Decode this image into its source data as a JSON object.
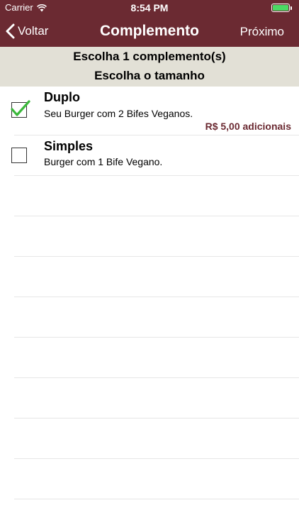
{
  "status_bar": {
    "carrier": "Carrier",
    "time": "8:54 PM",
    "battery_level": 1.0
  },
  "nav": {
    "back_label": "Voltar",
    "title": "Complemento",
    "next_label": "Próximo"
  },
  "section": {
    "line1": "Escolha 1 complemento(s)",
    "line2": "Escolha o tamanho"
  },
  "options": [
    {
      "title": "Duplo",
      "description": "Seu Burger com 2 Bifes Veganos.",
      "price": "R$ 5,00 adicionais",
      "checked": true
    },
    {
      "title": "Simples",
      "description": "Burger com 1 Bife Vegano.",
      "price": "",
      "checked": false
    }
  ],
  "colors": {
    "nav_bg": "#6b2a32",
    "section_bg": "#e2e0d6",
    "price": "#6b2a32",
    "check": "#3bb83b",
    "battery": "#4cd964"
  }
}
